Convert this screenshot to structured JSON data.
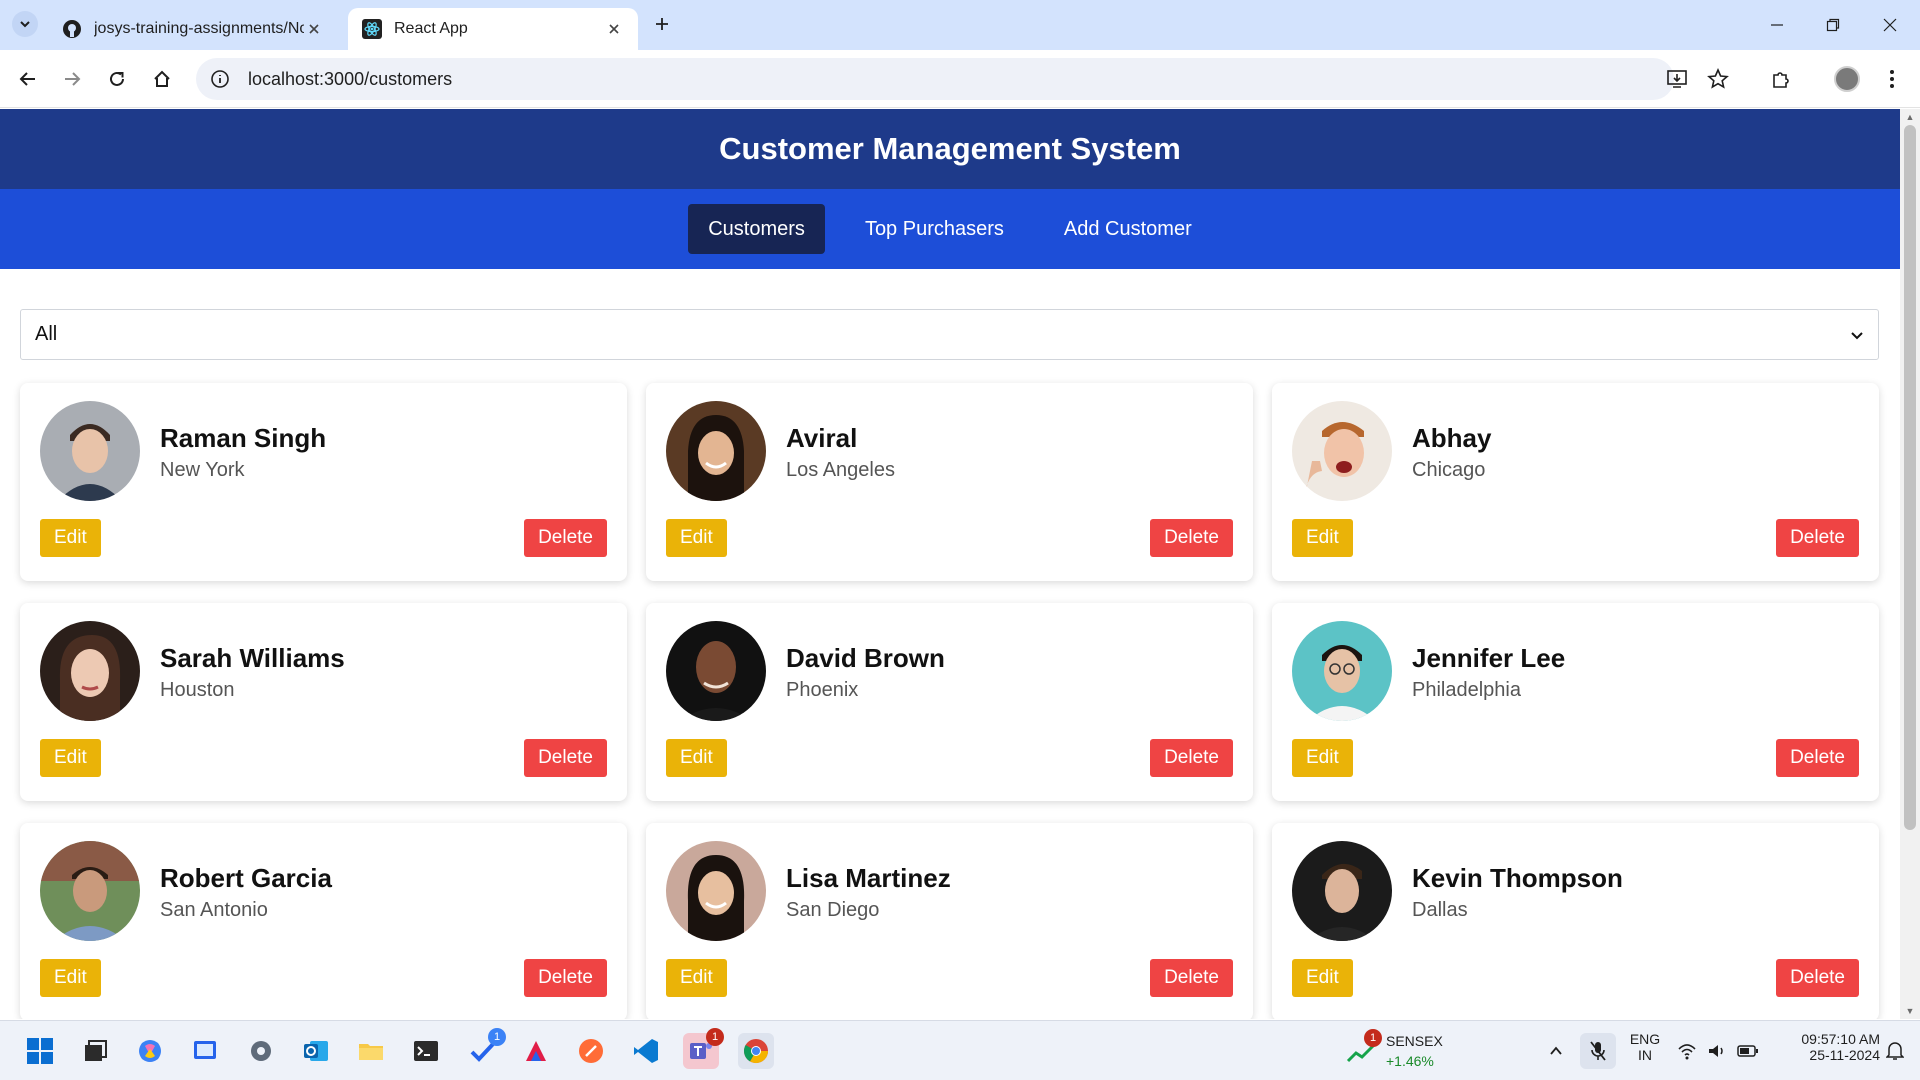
{
  "browser": {
    "tabs": [
      {
        "title": "josys-training-assignments/Nov",
        "active": false
      },
      {
        "title": "React App",
        "active": true
      }
    ],
    "url": "localhost:3000/customers"
  },
  "app": {
    "title": "Customer Management System",
    "nav": [
      {
        "label": "Customers",
        "active": true
      },
      {
        "label": "Top Purchasers",
        "active": false
      },
      {
        "label": "Add Customer",
        "active": false
      }
    ],
    "filter": {
      "value": "All"
    },
    "customers": [
      {
        "name": "Raman Singh",
        "city": "New York"
      },
      {
        "name": "Aviral",
        "city": "Los Angeles"
      },
      {
        "name": "Abhay",
        "city": "Chicago"
      },
      {
        "name": "Sarah Williams",
        "city": "Houston"
      },
      {
        "name": "David Brown",
        "city": "Phoenix"
      },
      {
        "name": "Jennifer Lee",
        "city": "Philadelphia"
      },
      {
        "name": "Robert Garcia",
        "city": "San Antonio"
      },
      {
        "name": "Lisa Martinez",
        "city": "San Diego"
      },
      {
        "name": "Kevin Thompson",
        "city": "Dallas"
      }
    ],
    "edit_label": "Edit",
    "delete_label": "Delete",
    "colors": {
      "header": "#1e3a8a",
      "nav": "#1d4ed8",
      "nav_active": "#172554",
      "edit": "#eab308",
      "delete": "#ef4444"
    }
  },
  "taskbar": {
    "sensex": {
      "name": "SENSEX",
      "change": "+1.46%",
      "badge": "1"
    },
    "teams_badge": "1",
    "todo_badge": "1",
    "language": {
      "lang": "ENG",
      "region": "IN"
    },
    "time": "09:57:10 AM",
    "date": "25-11-2024"
  }
}
